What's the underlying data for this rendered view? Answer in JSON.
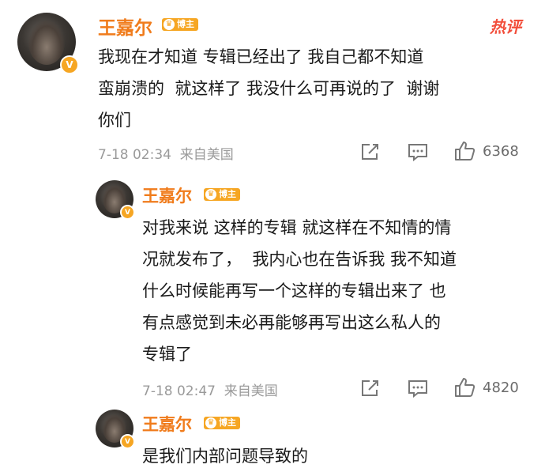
{
  "hot_label": "热评",
  "comments": [
    {
      "username": "王嘉尔",
      "badge": "博主",
      "text": "我现在才知道 专辑已经出了 我自己都不知道\n蛮崩溃的  就这样了 我没什么可再说的了  谢谢\n你们",
      "time": "7-18 02:34",
      "location": "来自美国",
      "likes": "6368"
    },
    {
      "username": "王嘉尔",
      "badge": "博主",
      "text": "对我来说 这样的专辑 就这样在不知情的情\n况就发布了，  我内心也在告诉我 我不知道\n什么时候能再写一个这样的专辑出来了 也\n有点感觉到未必再能够再写出这么私人的\n专辑了",
      "time": "7-18 02:47",
      "location": "来自美国",
      "likes": "4820"
    },
    {
      "username": "王嘉尔",
      "badge": "博主",
      "text": "是我们内部问题导致的"
    }
  ],
  "icons": [
    "share-icon",
    "comment-icon",
    "like-icon",
    "verified-v-icon"
  ],
  "colors": {
    "name": "#f07c1c",
    "badge": "#f6a623",
    "hot": "#f24e3b",
    "meta": "#9a9a9a"
  }
}
